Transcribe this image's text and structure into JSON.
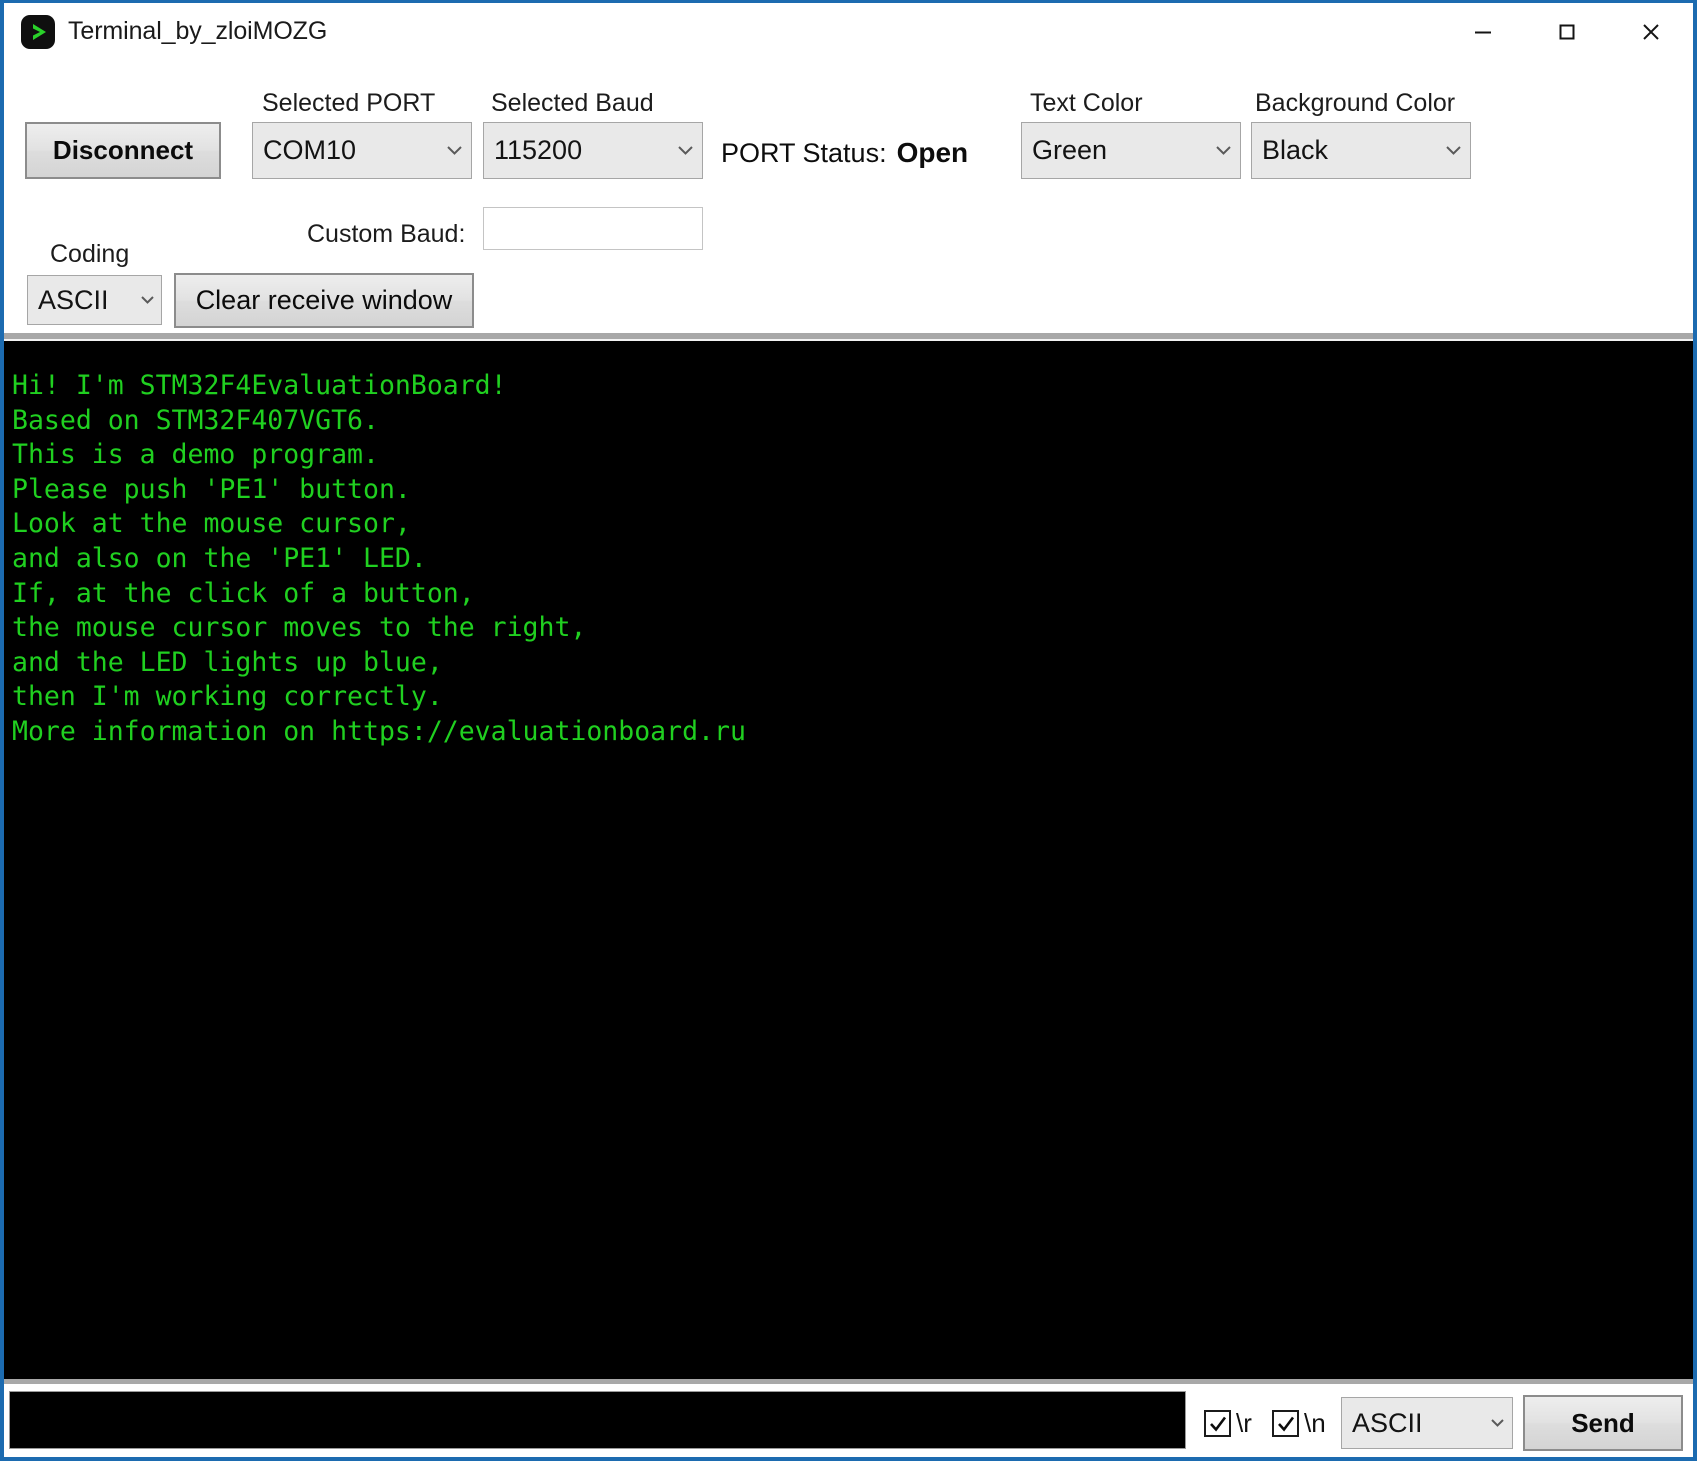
{
  "window": {
    "title": "Terminal_by_zloiMOZG",
    "icon": "play-triangle-icon",
    "controls": [
      {
        "name": "minimize",
        "label": "—"
      },
      {
        "name": "maximize",
        "label": "□"
      },
      {
        "name": "close",
        "label": "✕"
      }
    ],
    "border_color": "#1c6bb0"
  },
  "toolbar": {
    "connect_button": "Disconnect",
    "port_label": "Selected PORT",
    "port_value": "COM10",
    "baud_label": "Selected Baud",
    "baud_value": "115200",
    "status_label": "PORT Status:",
    "status_value": "Open",
    "text_color_label": "Text Color",
    "text_color_value": "Green",
    "background_color_label": "Background Color",
    "background_color_value": "Black",
    "custom_baud_label": "Custom Baud:",
    "custom_baud_value": "",
    "custom_baud_placeholder": "",
    "coding_label": "Coding",
    "coding_value": "ASCII",
    "clear_button": "Clear receive window"
  },
  "terminal": {
    "background_color": "#000000",
    "text_color": "#20d020",
    "lines": [
      "Hi! I'm STM32F4EvaluationBoard!",
      "Based on STM32F407VGT6.",
      "This is a demo program.",
      "Please push 'PE1' button.",
      "Look at the mouse cursor,",
      "and also on the 'PE1' LED.",
      "If, at the click of a button,",
      "the mouse cursor moves to the right,",
      "and the LED lights up blue,",
      "then I'm working correctly.",
      "More information on https://evaluationboard.ru"
    ],
    "text": "Hi! I'm STM32F4EvaluationBoard!\nBased on STM32F407VGT6.\nThis is a demo program.\nPlease push 'PE1' button.\nLook at the mouse cursor,\nand also on the 'PE1' LED.\nIf, at the click of a button,\nthe mouse cursor moves to the right,\nand the LED lights up blue,\nthen I'm working correctly.\nMore information on https://evaluationboard.ru"
  },
  "sendbar": {
    "input_value": "",
    "input_placeholder": "",
    "cr_label": "\\r",
    "cr_checked": true,
    "lf_label": "\\n",
    "lf_checked": true,
    "coding_value": "ASCII",
    "send_button": "Send"
  }
}
